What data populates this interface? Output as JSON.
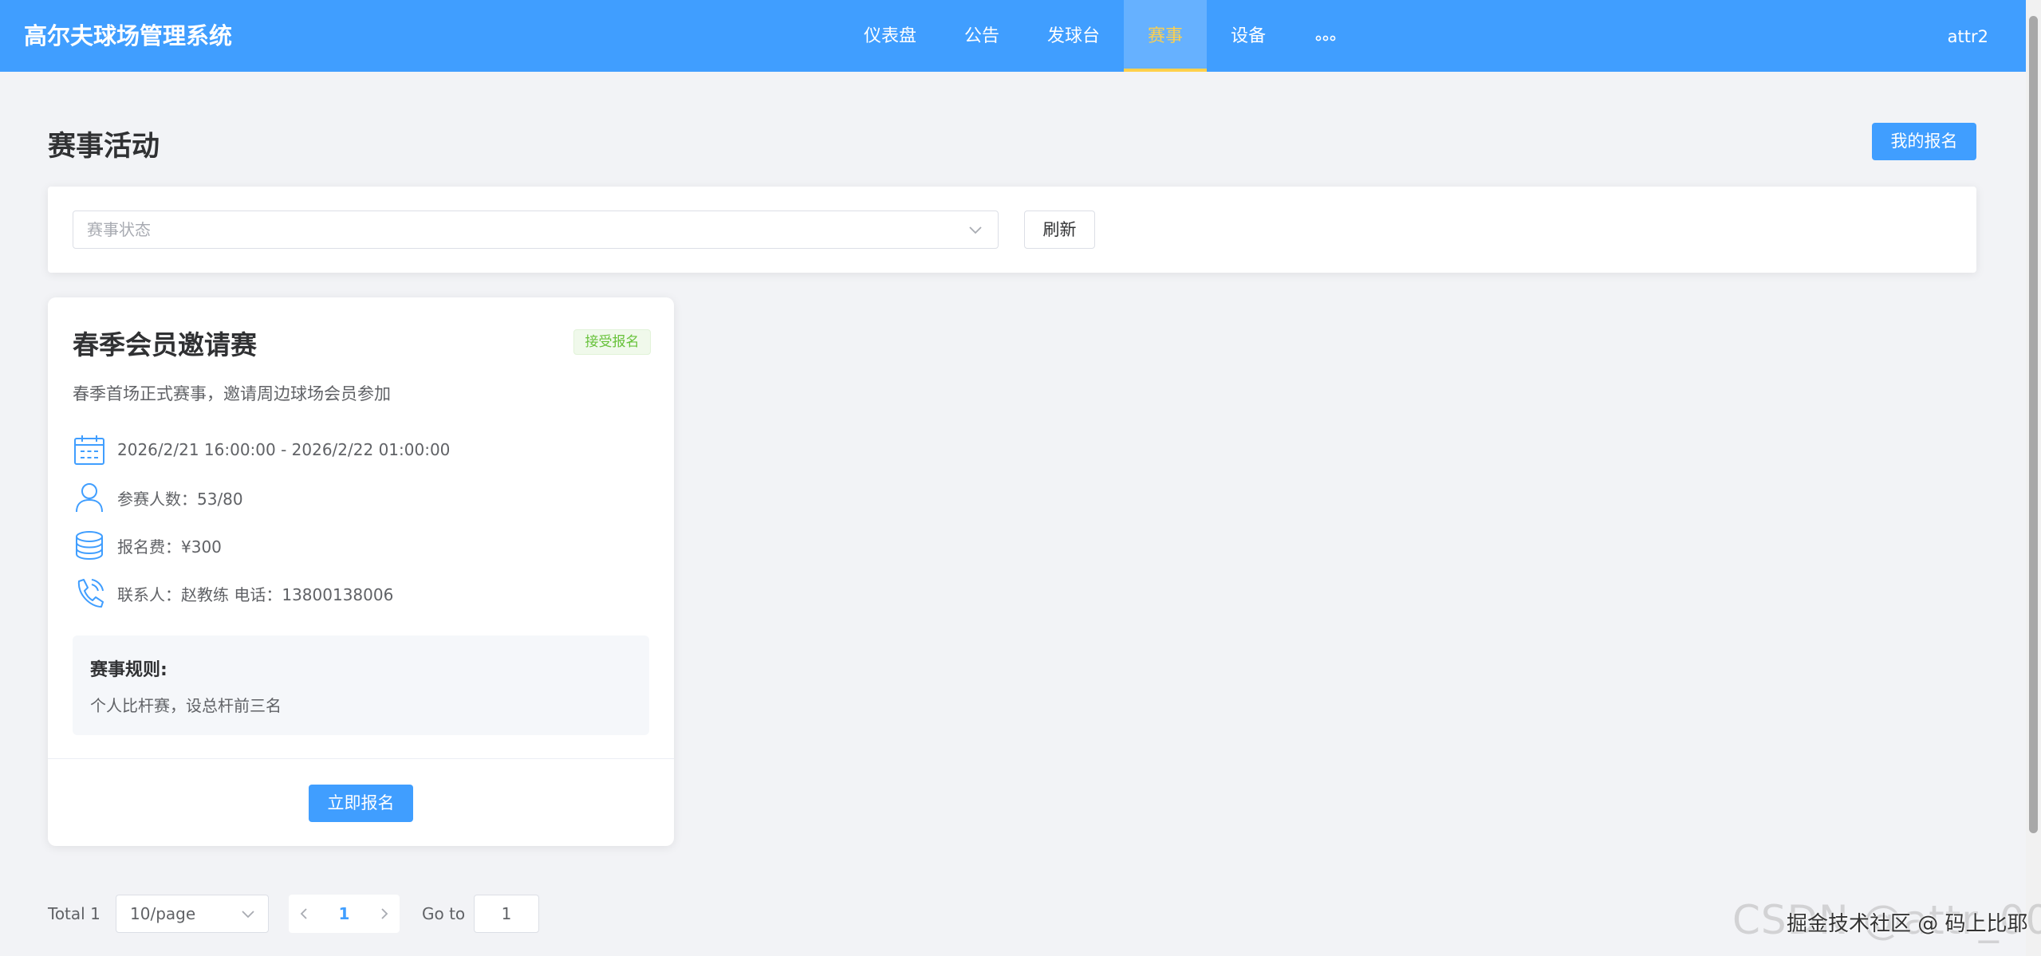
{
  "app": {
    "title": "高尔夫球场管理系统",
    "user": "attr2"
  },
  "nav": {
    "items": [
      {
        "label": "仪表盘"
      },
      {
        "label": "公告"
      },
      {
        "label": "发球台"
      },
      {
        "label": "赛事"
      },
      {
        "label": "设备"
      }
    ],
    "active": "赛事",
    "more_icon": "ellipsis-icon"
  },
  "page": {
    "title": "赛事活动",
    "my_signup_label": "我的报名"
  },
  "filter": {
    "status_placeholder": "赛事状态",
    "refresh_label": "刷新"
  },
  "events": [
    {
      "title": "春季会员邀请赛",
      "status": "接受报名",
      "description": "春季首场正式赛事，邀请周边球场会员参加",
      "time": "2026/2/21 16:00:00 - 2026/2/22 01:00:00",
      "participants": "参赛人数：53/80",
      "fee": "报名费：¥300",
      "contact": "联系人：赵教练 电话：13800138006",
      "rules_title": "赛事规则:",
      "rules": "个人比杆赛，设总杆前三名",
      "signup_label": "立即报名"
    }
  ],
  "pagination": {
    "total": "Total 1",
    "page_size": "10/page",
    "current_page": "1",
    "goto_label": "Go to",
    "goto_value": "1"
  },
  "watermark": {
    "csdn": "CSDN @attr_001",
    "juejin": "掘金技术社区 @ 码上比耶"
  },
  "colors": {
    "primary": "#409eff",
    "active_nav_text": "#ffd04b",
    "success_tag": "#67c23a",
    "page_bg": "#f2f3f6"
  }
}
